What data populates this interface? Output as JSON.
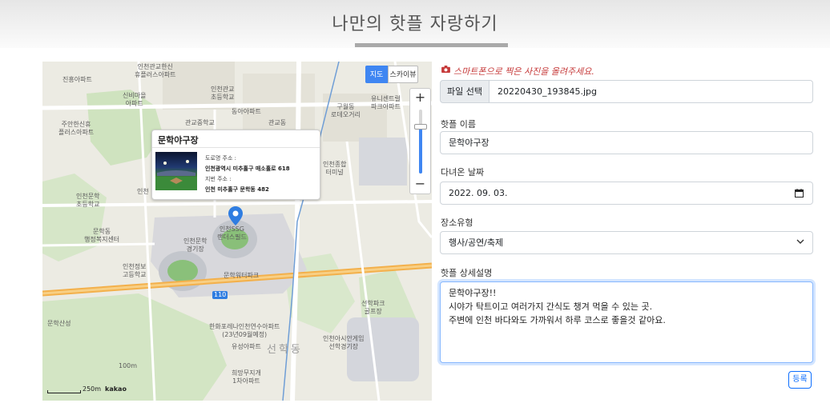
{
  "page": {
    "title": "나만의 핫플 자랑하기"
  },
  "map": {
    "maptype": {
      "map_label": "지도",
      "skyview_label": "스카이뷰"
    },
    "zoom": {
      "in_label": "+",
      "out_label": "−"
    },
    "popup": {
      "title": "문학야구장",
      "road_addr_label": "도로명 주소 :",
      "road_addr": "인천광역시 미추홀구 매소홀로 618",
      "jibun_label": "지번 주소 :",
      "jibun_addr": "인천 미추홀구 문학동 482"
    },
    "scale": {
      "label": "250m",
      "brand": "kakao"
    },
    "labels": {
      "l1": "인천관교한신\n휴플러스아파트",
      "l2": "진흥아파트",
      "l3": "신비마을\n아파트",
      "l4": "인천관교\n초등학교",
      "l5": "동아아파트",
      "l6": "관교중학교",
      "l7": "관교동",
      "l8": "구월동\n로데오거리",
      "l9": "유니센트럴\n파크아파트",
      "l10": "주안한신휴\n플러스아파트",
      "l11": "인천종합\n터미널",
      "l12": "인천문학\n초등학교",
      "l13": "인천",
      "l14": "문학동\n행정복지센터",
      "l15": "인천문학\n경기장",
      "l16": "인천SSG\n랜더스필드",
      "l17": "인천정보\n고등학교",
      "l18": "문학워터파크",
      "l19": "110",
      "l20": "선학파크\n골프장",
      "l21": "문학산성",
      "l22": "한화포레나인천연수아파트\n(23년09월예정)",
      "l23": "유성아파트",
      "l24": "인천아시안게임\n선학경기장",
      "l25": "100m",
      "l26": "희망무지개\n1차아파트",
      "l27": "선학동"
    }
  },
  "form": {
    "upload_hint": "스마트폰으로 찍은 사진을 올려주세요.",
    "file_button": "파일 선택",
    "file_name": "20220430_193845.jpg",
    "name_label": "핫플 이름",
    "name_value": "문학야구장",
    "date_label": "다녀온 날짜",
    "date_value": "2022. 09. 03.",
    "type_label": "장소유형",
    "type_value": "행사/공연/축제",
    "desc_label": "핫플 상세설명",
    "desc_lines": [
      "문학야구장!!",
      "시야가 탁트이고 여러가지 간식도 챙겨 먹을 수 있는 곳.",
      "주변에 인천 바다와도 가까워서 하루 코스로 좋을것 같아요."
    ],
    "submit_label": "등록"
  },
  "colors": {
    "accent": "#0d6efd",
    "map_accent": "#3f86f2",
    "hint": "#c63a3a",
    "pin": "#2f7de1"
  }
}
